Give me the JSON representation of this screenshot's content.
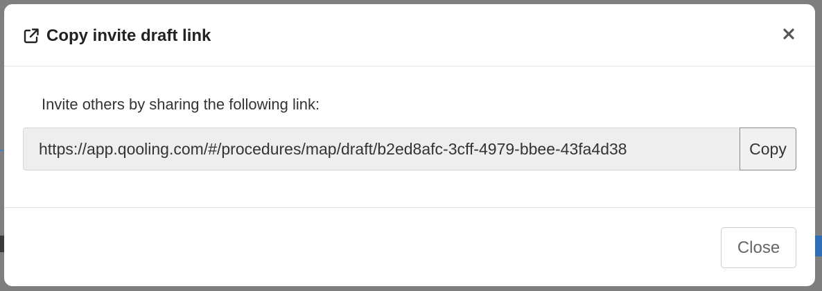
{
  "modal": {
    "title": "Copy invite draft link",
    "title_icon": "external-link-icon",
    "close_icon": "close-icon",
    "instruction": "Invite others by sharing the following link:",
    "link_value": "https://app.qooling.com/#/procedures/map/draft/b2ed8afc-3cff-4979-bbee-43fa4d38",
    "copy_label": "Copy",
    "close_label": "Close"
  },
  "colors": {
    "backdrop": "#7f7f7f",
    "modal_bg": "#ffffff",
    "title_text": "#222222",
    "input_bg": "#eeeeee"
  }
}
